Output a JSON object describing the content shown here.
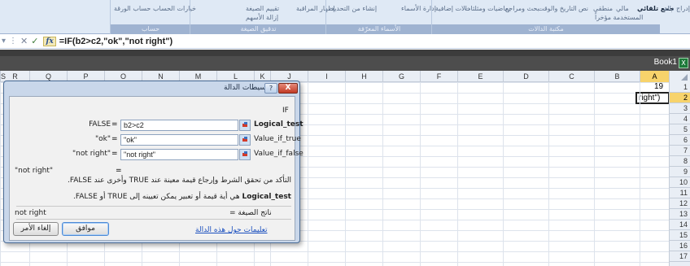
{
  "ribbon": {
    "groups": [
      {
        "label": "حساب",
        "buttons": [
          "خيارات الحساب",
          "حساب الورقة"
        ]
      },
      {
        "label": "تدقيق الصيغة",
        "buttons": [
          "إظهار المراقبة",
          "تقييم الصيغة",
          "إزالة الأسهم"
        ]
      },
      {
        "label": "الأسماء المعرّفة",
        "buttons": [
          "إدارة الأسماء",
          "إنشاء من التحديد"
        ]
      },
      {
        "label": "مكتبة الدالات",
        "buttons": [
          "دالات إضافية",
          "رياضيات ومثلثات",
          "بحث ومراجع",
          "التاريخ والوقت",
          "نص",
          "منطقي",
          "مالي",
          "المستخدمة مؤخراً",
          "جمع تلقائي"
        ]
      }
    ],
    "right_edge": "إدراج دالة"
  },
  "formula_bar": {
    "formula": "=IF(b2>c2,\"ok\",\"not right\")"
  },
  "workbook": {
    "title": "Book1"
  },
  "columns": [
    "A",
    "B",
    "C",
    "D",
    "E",
    "F",
    "G",
    "H",
    "I",
    "J",
    "K",
    "L",
    "M",
    "N",
    "O",
    "P",
    "Q",
    "R",
    "S"
  ],
  "rows": [
    "1",
    "2",
    "3",
    "4",
    "5",
    "6",
    "7",
    "8",
    "9",
    "10",
    "11",
    "12",
    "13",
    "14",
    "15",
    "16",
    "17"
  ],
  "cells": {
    "a1": "19",
    "a2": "right\")"
  },
  "dialog": {
    "title": "وسيطات الدالة",
    "help_label": "?",
    "close_label": "X",
    "function_name": "IF",
    "args": [
      {
        "label": "FALSE",
        "value": "b2>c2",
        "name": "Logical_test"
      },
      {
        "label": "\"ok\"",
        "value": "\"ok\"",
        "name": "Value_if_true"
      },
      {
        "label": "\"not right\"",
        "value": "\"not right\"",
        "name": "Value_if_false"
      }
    ],
    "equals": "=",
    "result_preview": "\"not right\"",
    "description": "التأكد من تحقق الشرط وإرجاع قيمة معينة عند TRUE وأخرى عند FALSE.",
    "arg_description_name": "Logical_test",
    "arg_description": "هي أية قيمة أو تعبير يمكن تعيينه إلى TRUE أو FALSE.",
    "result_label": "ناتج الصيغة =",
    "result_value": "not right",
    "help_link": "تعليمات حول هذه الدالة",
    "ok_label": "موافق",
    "cancel_label": "إلغاء الأمر"
  }
}
